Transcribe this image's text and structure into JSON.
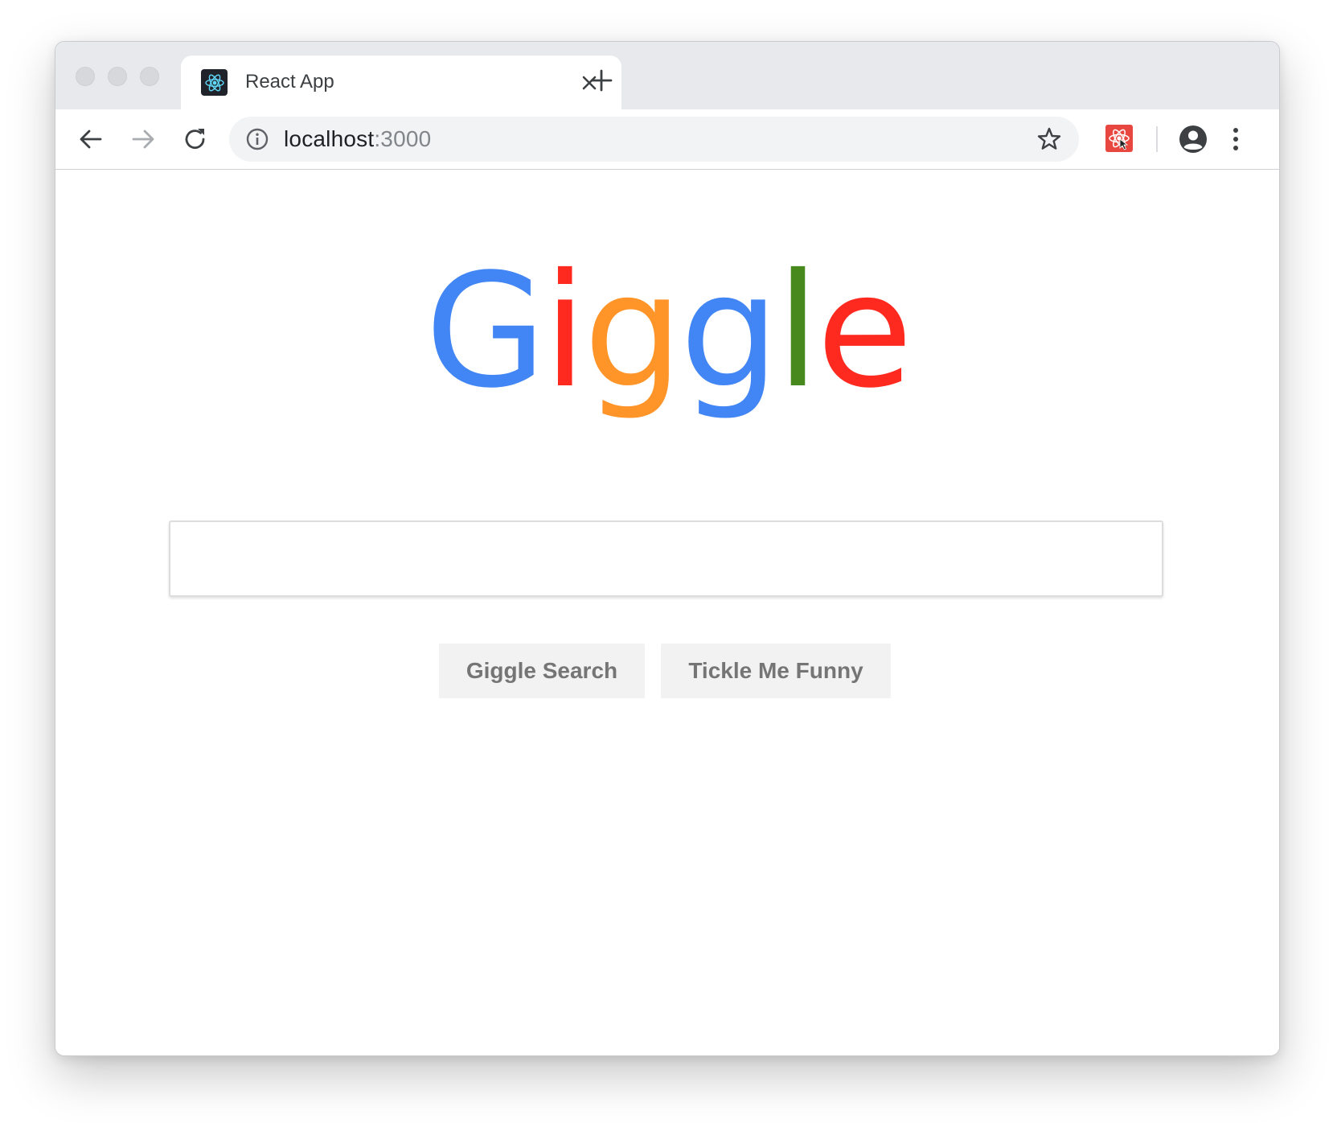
{
  "window": {
    "traffic_lights": [
      "close",
      "minimize",
      "maximize"
    ]
  },
  "tab": {
    "title": "React App",
    "favicon": "react-logo-icon",
    "close_icon": "close-icon"
  },
  "new_tab_icon": "plus-icon",
  "toolbar": {
    "back_icon": "arrow-back-icon",
    "forward_icon": "arrow-forward-icon",
    "reload_icon": "reload-icon",
    "address": {
      "host": "localhost",
      "port": ":3000",
      "security_icon": "info-icon",
      "bookmark_icon": "star-icon"
    },
    "extension_icon": "react-devtools-extension-icon",
    "profile_icon": "account-circle-icon",
    "menu_icon": "more-vert-icon"
  },
  "page": {
    "logo_letters": [
      {
        "char": "G",
        "color": "#4285f4"
      },
      {
        "char": "i",
        "color": "#ff2a1f"
      },
      {
        "char": "g",
        "color": "#ff9428"
      },
      {
        "char": "g",
        "color": "#4285f4"
      },
      {
        "char": "l",
        "color": "#48891d"
      },
      {
        "char": "e",
        "color": "#ff2a1f"
      }
    ],
    "search_input": {
      "value": "",
      "placeholder": ""
    },
    "buttons": {
      "search_label": "Giggle Search",
      "lucky_label": "Tickle Me Funny"
    }
  }
}
